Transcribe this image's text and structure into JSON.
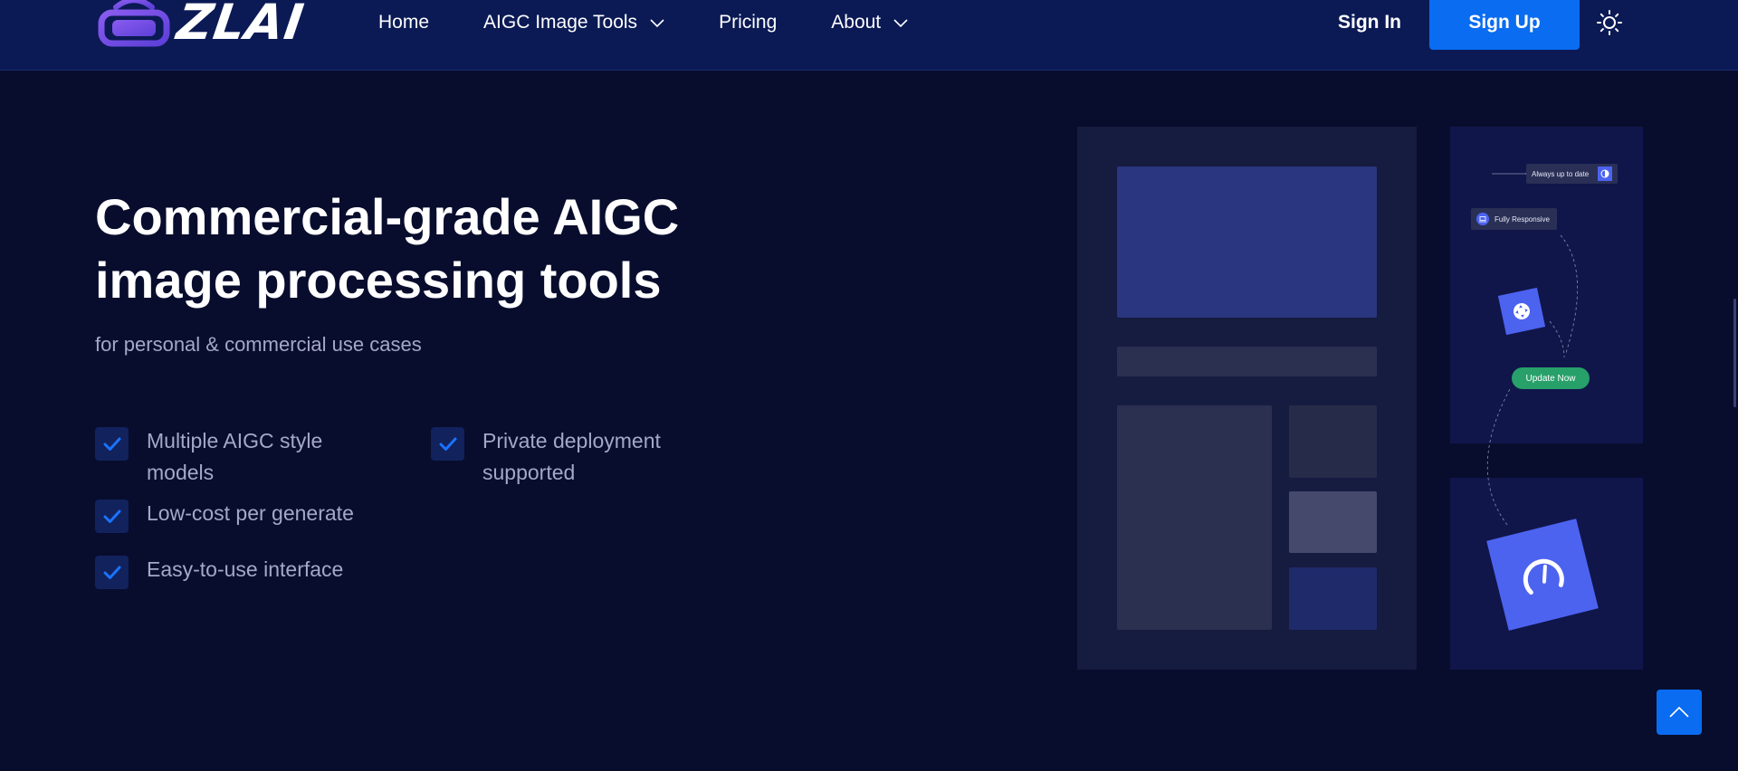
{
  "header": {
    "brand": "ZLAI",
    "nav": [
      {
        "label": "Home",
        "has_dropdown": false
      },
      {
        "label": "AIGC Image Tools",
        "has_dropdown": true
      },
      {
        "label": "Pricing",
        "has_dropdown": false
      },
      {
        "label": "About",
        "has_dropdown": true
      }
    ],
    "sign_in": "Sign In",
    "sign_up": "Sign Up",
    "theme_icon": "sun-icon"
  },
  "hero": {
    "title_line1": "Commercial-grade AIGC",
    "title_line2": "image processing tools",
    "subtitle": "for personal & commercial use cases",
    "features": [
      {
        "line1": "Multiple AIGC style",
        "line2": "models"
      },
      {
        "line1": "Private deployment",
        "line2": "supported"
      },
      {
        "line1": "Low-cost per generate",
        "line2": ""
      },
      {
        "line1": "Easy-to-use interface",
        "line2": ""
      }
    ]
  },
  "illustration": {
    "tag_up_to_date": "Always up to date",
    "tag_responsive": "Fully Responsive",
    "update_button": "Update Now"
  },
  "colors": {
    "background": "#080d2e",
    "header": "#0b1a55",
    "accent": "#0a6cf0",
    "illustration_blue": "#4c63f0",
    "update_green": "#27a06a"
  }
}
